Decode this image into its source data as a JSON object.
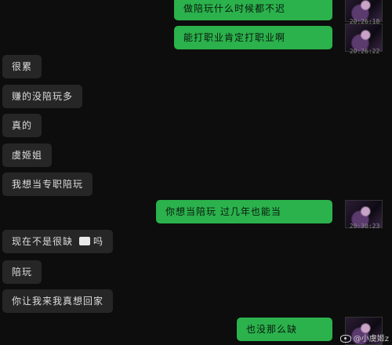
{
  "messages": [
    {
      "id": "m1",
      "side": "out",
      "text": "做陪玩什么时候都不迟",
      "time": "20:26:18"
    },
    {
      "id": "m2",
      "side": "out",
      "text": "能打职业肯定打职业啊",
      "time": "20:26:22"
    },
    {
      "id": "m3",
      "side": "in",
      "text": "很累"
    },
    {
      "id": "m4",
      "side": "in",
      "text": "赚的没陪玩多"
    },
    {
      "id": "m5",
      "side": "in",
      "text": "真的"
    },
    {
      "id": "m6",
      "side": "in",
      "text": "虞姬姐"
    },
    {
      "id": "m7",
      "side": "in",
      "text": "我想当专职陪玩"
    },
    {
      "id": "m8",
      "side": "out",
      "text": "你想当陪玩 过几年也能当",
      "time": "20:30:23"
    },
    {
      "id": "m9",
      "side": "in",
      "text_before": "现在不是很缺",
      "text_after": "吗",
      "icon": "image-placeholder-icon"
    },
    {
      "id": "m10",
      "side": "in",
      "text": "陪玩"
    },
    {
      "id": "m11",
      "side": "in",
      "text": "你让我来我真想回家"
    },
    {
      "id": "m12",
      "side": "out",
      "text": "也没那么缺"
    }
  ],
  "watermark": "@小虞姬z"
}
